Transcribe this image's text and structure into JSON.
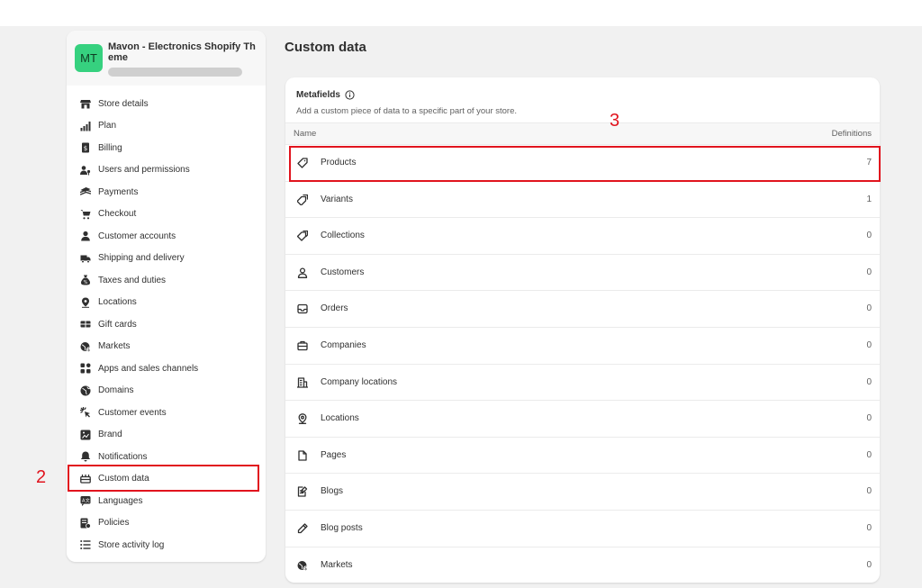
{
  "store": {
    "avatar_initials": "MT",
    "name": "Mavon - Electronics Shopify Theme"
  },
  "sidebar": {
    "items": [
      {
        "label": "Store details",
        "icon": "store-icon"
      },
      {
        "label": "Plan",
        "icon": "plan-chart-icon"
      },
      {
        "label": "Billing",
        "icon": "billing-icon"
      },
      {
        "label": "Users and permissions",
        "icon": "users-icon"
      },
      {
        "label": "Payments",
        "icon": "payments-icon"
      },
      {
        "label": "Checkout",
        "icon": "cart-icon"
      },
      {
        "label": "Customer accounts",
        "icon": "person-icon"
      },
      {
        "label": "Shipping and delivery",
        "icon": "truck-icon"
      },
      {
        "label": "Taxes and duties",
        "icon": "tax-bag-icon"
      },
      {
        "label": "Locations",
        "icon": "location-pin-icon"
      },
      {
        "label": "Gift cards",
        "icon": "gift-card-icon"
      },
      {
        "label": "Markets",
        "icon": "globe-dollar-icon"
      },
      {
        "label": "Apps and sales channels",
        "icon": "apps-icon"
      },
      {
        "label": "Domains",
        "icon": "globe-icon"
      },
      {
        "label": "Customer events",
        "icon": "cursor-click-icon"
      },
      {
        "label": "Brand",
        "icon": "brand-icon"
      },
      {
        "label": "Notifications",
        "icon": "bell-icon"
      },
      {
        "label": "Custom data",
        "icon": "custom-data-icon",
        "active": true
      },
      {
        "label": "Languages",
        "icon": "language-icon"
      },
      {
        "label": "Policies",
        "icon": "policies-icon"
      },
      {
        "label": "Store activity log",
        "icon": "list-icon"
      }
    ]
  },
  "annotations": {
    "sidebar_marker": "2",
    "row_marker": "3",
    "color": "#e1141e"
  },
  "main": {
    "title": "Custom data",
    "card": {
      "title": "Metafields",
      "subtitle": "Add a custom piece of data to a specific part of your store.",
      "columns": {
        "name": "Name",
        "definitions": "Definitions"
      },
      "rows": [
        {
          "label": "Products",
          "count": "7",
          "icon": "tag-icon"
        },
        {
          "label": "Variants",
          "count": "1",
          "icon": "variants-icon"
        },
        {
          "label": "Collections",
          "count": "0",
          "icon": "collection-tags-icon"
        },
        {
          "label": "Customers",
          "count": "0",
          "icon": "person-outline-icon"
        },
        {
          "label": "Orders",
          "count": "0",
          "icon": "inbox-icon"
        },
        {
          "label": "Companies",
          "count": "0",
          "icon": "briefcase-icon"
        },
        {
          "label": "Company locations",
          "count": "0",
          "icon": "building-icon"
        },
        {
          "label": "Locations",
          "count": "0",
          "icon": "pin-outline-icon"
        },
        {
          "label": "Pages",
          "count": "0",
          "icon": "page-icon"
        },
        {
          "label": "Blogs",
          "count": "0",
          "icon": "blog-icon"
        },
        {
          "label": "Blog posts",
          "count": "0",
          "icon": "pen-icon"
        },
        {
          "label": "Markets",
          "count": "0",
          "icon": "globe-dollar-icon"
        }
      ]
    }
  }
}
